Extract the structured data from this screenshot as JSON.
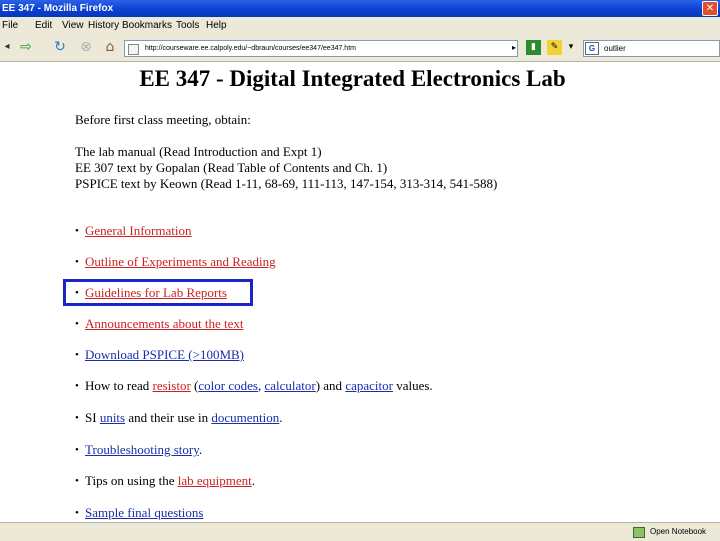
{
  "window": {
    "title": "EE 347 - Mozilla Firefox",
    "close_glyph": "✕"
  },
  "menu": {
    "items": [
      "File",
      "Edit",
      "View",
      "History",
      "Bookmarks",
      "Tools",
      "Help"
    ]
  },
  "navbar": {
    "back_glyph": "◂",
    "forward_glyph": "⇨",
    "reload_glyph": "↻",
    "stop_glyph": "⊗",
    "home_glyph": "⌂",
    "url": "http://courseware.ee.calpoly.edu/~dbraun/courses/ee347/ee347.htm",
    "go_glyph": "▸",
    "search_text": "outlier"
  },
  "page": {
    "heading": "EE 347 - Digital Integrated Electronics Lab",
    "intro": "Before first class meeting, obtain:",
    "resources": [
      "The lab manual (Read Introduction and Expt 1)",
      "EE 307 text by Gopalan (Read Table of Contents and Ch. 1)",
      "PSPICE text by Keown (Read 1-11, 68-69, 111-113, 147-154, 313-314, 541-588)"
    ],
    "bullet_glyph": "•",
    "links": {
      "general_info": "General Information",
      "outline": "Outline of Experiments and Reading",
      "guidelines": "Guidelines for Lab Reports",
      "announcements": "Announcements about the text",
      "download_pspice": " Download PSPICE (>100MB)",
      "read_prefix": "How to read ",
      "resistor": "resistor",
      "read_open_paren": " (",
      "color_codes": "color codes",
      "read_comma": ", ",
      "calculator": "calculator",
      "read_and": ") and ",
      "capacitor": "capacitor",
      "read_suffix": " values.",
      "si_prefix": "SI ",
      "units": "units",
      "si_mid": " and their use in ",
      "documention": "documention",
      "period": ".",
      "troubleshooting": "Troubleshooting story",
      "tips_prefix": "Tips on using the ",
      "lab_equipment": "lab equipment",
      "sample_final": "Sample final questions"
    }
  },
  "status": {
    "notebook": "Open Notebook"
  }
}
